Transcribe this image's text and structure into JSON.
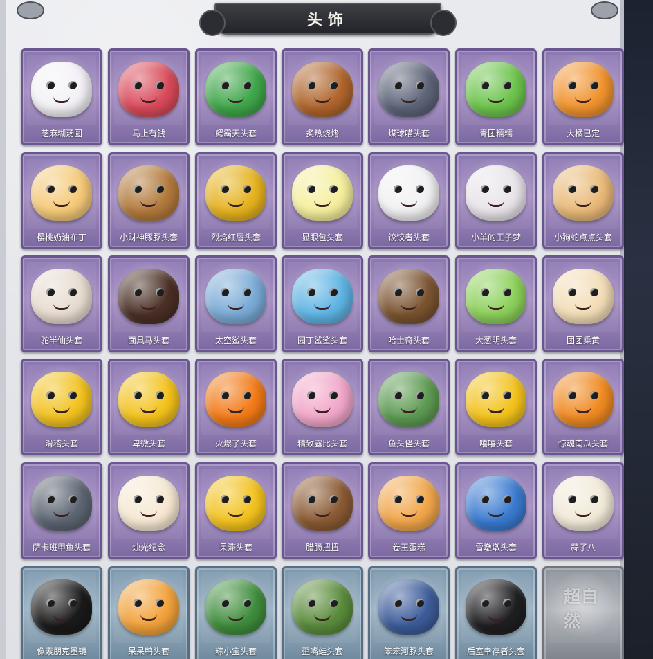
{
  "title": "头饰",
  "items": [
    {
      "label": "芝麻糊汤圆",
      "icon": "tangyuan-head-icon",
      "color": "#f3f1f6",
      "theme": "purple"
    },
    {
      "label": "马上有钱",
      "icon": "horse-head-icon",
      "color": "#d94a5a",
      "theme": "purple"
    },
    {
      "label": "鳄霸天头套",
      "icon": "crocodile-head-icon",
      "color": "#3fa64a",
      "theme": "purple"
    },
    {
      "label": "炙热烧烤",
      "icon": "barbecue-head-icon",
      "color": "#b0652c",
      "theme": "purple"
    },
    {
      "label": "煤球喵头套",
      "icon": "cat-head-icon",
      "color": "#5d6478",
      "theme": "purple"
    },
    {
      "label": "青团糯糯",
      "icon": "qingtuan-head-icon",
      "color": "#6cc44c",
      "theme": "purple"
    },
    {
      "label": "大橘已定",
      "icon": "orange-head-icon",
      "color": "#f0932e",
      "theme": "purple"
    },
    {
      "label": "樱桃奶油布丁",
      "icon": "pudding-head-icon",
      "color": "#f5c978",
      "theme": "purple"
    },
    {
      "label": "小财神豚豚头套",
      "icon": "capybara-head-icon",
      "color": "#b27a3c",
      "theme": "purple"
    },
    {
      "label": "烈焰红唇头套",
      "icon": "pikachu-head-icon",
      "color": "#e5b21f",
      "theme": "purple"
    },
    {
      "label": "显眼包头套",
      "icon": "bulb-head-icon",
      "color": "#f5ef9c",
      "theme": "purple"
    },
    {
      "label": "饺饺者头套",
      "icon": "cloud-head-icon",
      "color": "#f1f1f3",
      "theme": "purple"
    },
    {
      "label": "小羊的王子梦",
      "icon": "sheep-head-icon",
      "color": "#e8e4ea",
      "theme": "purple"
    },
    {
      "label": "小狗蛇点点头套",
      "icon": "dog-snake-head-icon",
      "color": "#e9b978",
      "theme": "purple"
    },
    {
      "label": "驼半仙头套",
      "icon": "alpaca-head-icon",
      "color": "#e7dcd0",
      "theme": "purple"
    },
    {
      "label": "面具马头套",
      "icon": "horse-mask-head-icon",
      "color": "#4a2f25",
      "theme": "purple"
    },
    {
      "label": "太空鲨头套",
      "icon": "shark-head-icon",
      "color": "#7aaad6",
      "theme": "purple"
    },
    {
      "label": "园丁鲨鲨头套",
      "icon": "gardener-shark-head-icon",
      "color": "#5fb4e4",
      "theme": "purple"
    },
    {
      "label": "哈士奇头套",
      "icon": "husky-head-icon",
      "color": "#7a5330",
      "theme": "purple"
    },
    {
      "label": "大葱明头套",
      "icon": "scallion-head-icon",
      "color": "#8cd05a",
      "theme": "purple"
    },
    {
      "label": "团团乘黄",
      "icon": "hamster-head-icon",
      "color": "#f3ddb6",
      "theme": "purple"
    },
    {
      "label": "滑稽头套",
      "icon": "funny-face-head-icon",
      "color": "#f2c21f",
      "theme": "purple"
    },
    {
      "label": "卑微头套",
      "icon": "humble-face-head-icon",
      "color": "#f3c21c",
      "theme": "purple"
    },
    {
      "label": "火爆了头套",
      "icon": "fire-head-icon",
      "color": "#f27a18",
      "theme": "purple"
    },
    {
      "label": "精致露比头套",
      "icon": "pink-beaver-head-icon",
      "color": "#f2a7c9",
      "theme": "purple"
    },
    {
      "label": "鱼头怪头套",
      "icon": "fish-monster-head-icon",
      "color": "#5d9a52",
      "theme": "purple"
    },
    {
      "label": "嘻嘻头套",
      "icon": "grin-face-head-icon",
      "color": "#f3c21c",
      "theme": "purple"
    },
    {
      "label": "惊魂南瓜头套",
      "icon": "pumpkin-head-icon",
      "color": "#ef8a22",
      "theme": "purple"
    },
    {
      "label": "萨卡班甲鱼头套",
      "icon": "sacabambaspis-head-icon",
      "color": "#5c6572",
      "theme": "purple"
    },
    {
      "label": "烛光纪念",
      "icon": "candle-head-icon",
      "color": "#f6e8d2",
      "theme": "purple"
    },
    {
      "label": "呆滞头套",
      "icon": "dull-face-head-icon",
      "color": "#f2c21f",
      "theme": "purple"
    },
    {
      "label": "腊肠扭扭",
      "icon": "dachshund-head-icon",
      "color": "#8a5a34",
      "theme": "purple"
    },
    {
      "label": "卷王蛋糕",
      "icon": "cake-roll-head-icon",
      "color": "#f1a64a",
      "theme": "purple"
    },
    {
      "label": "雪墩墩头套",
      "icon": "snowman-head-icon",
      "color": "#3a7ad0",
      "theme": "purple"
    },
    {
      "label": "蒜了八",
      "icon": "garlic-head-icon",
      "color": "#f1ead8",
      "theme": "purple"
    },
    {
      "label": "像素朋克墨镜",
      "icon": "pixel-sunglasses-icon",
      "color": "#1a1a1a",
      "theme": "blue"
    },
    {
      "label": "呆呆鸭头套",
      "icon": "duck-head-icon",
      "color": "#f2a23a",
      "theme": "blue"
    },
    {
      "label": "粽小宝头套",
      "icon": "zongzi-head-icon",
      "color": "#3f8d3c",
      "theme": "blue"
    },
    {
      "label": "歪嘴蛙头套",
      "icon": "frog-head-icon",
      "color": "#5a8c3c",
      "theme": "blue"
    },
    {
      "label": "笨笨河豚头套",
      "icon": "pufferfish-head-icon",
      "color": "#3c5c9a",
      "theme": "blue"
    },
    {
      "label": "后室幸存者头套",
      "icon": "gas-mask-helmet-icon",
      "color": "#1f1f22",
      "theme": "blue"
    },
    {
      "label": "",
      "icon": "locked-placeholder-icon",
      "color": "#9a9ea6",
      "theme": "gray",
      "watermark": "超自然"
    }
  ]
}
